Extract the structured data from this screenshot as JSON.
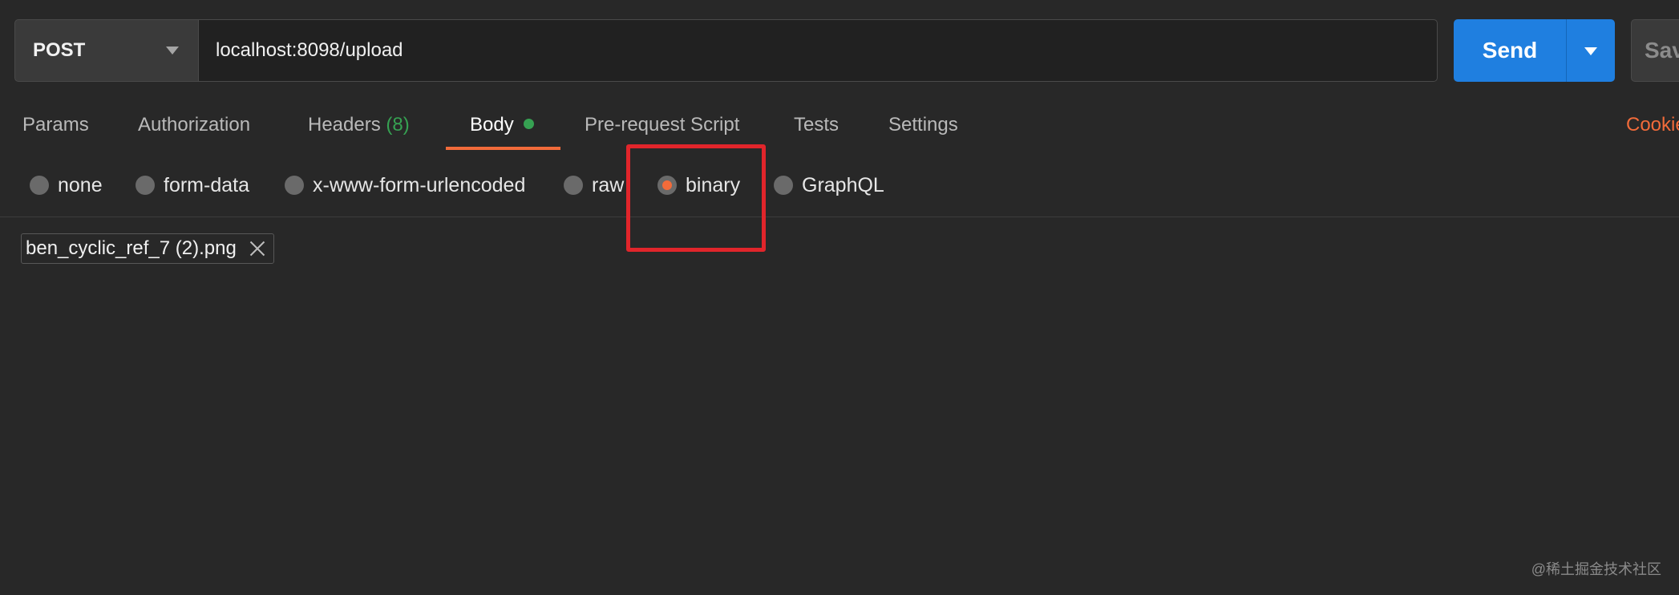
{
  "request": {
    "method": "POST",
    "url": "localhost:8098/upload",
    "send_label": "Send",
    "save_label": "Save"
  },
  "tabs": [
    {
      "label": "Params"
    },
    {
      "label": "Authorization"
    },
    {
      "label": "Headers",
      "count": "(8)"
    },
    {
      "label": "Body",
      "active": true,
      "indicator": "green-dot"
    },
    {
      "label": "Pre-request Script"
    },
    {
      "label": "Tests"
    },
    {
      "label": "Settings"
    }
  ],
  "cookies_label": "Cookies",
  "body_types": [
    {
      "label": "none",
      "selected": false
    },
    {
      "label": "form-data",
      "selected": false
    },
    {
      "label": "x-www-form-urlencoded",
      "selected": false
    },
    {
      "label": "raw",
      "selected": false
    },
    {
      "label": "binary",
      "selected": true
    },
    {
      "label": "GraphQL",
      "selected": false
    }
  ],
  "file": {
    "name": "ben_cyclic_ref_7 (2).png"
  },
  "watermark": "@稀土掘金技术社区",
  "colors": {
    "background": "#282828",
    "accent": "#f26b3a",
    "send_button": "#1f7fe0",
    "count_green": "#36a152",
    "highlight_red": "#e1252b"
  }
}
